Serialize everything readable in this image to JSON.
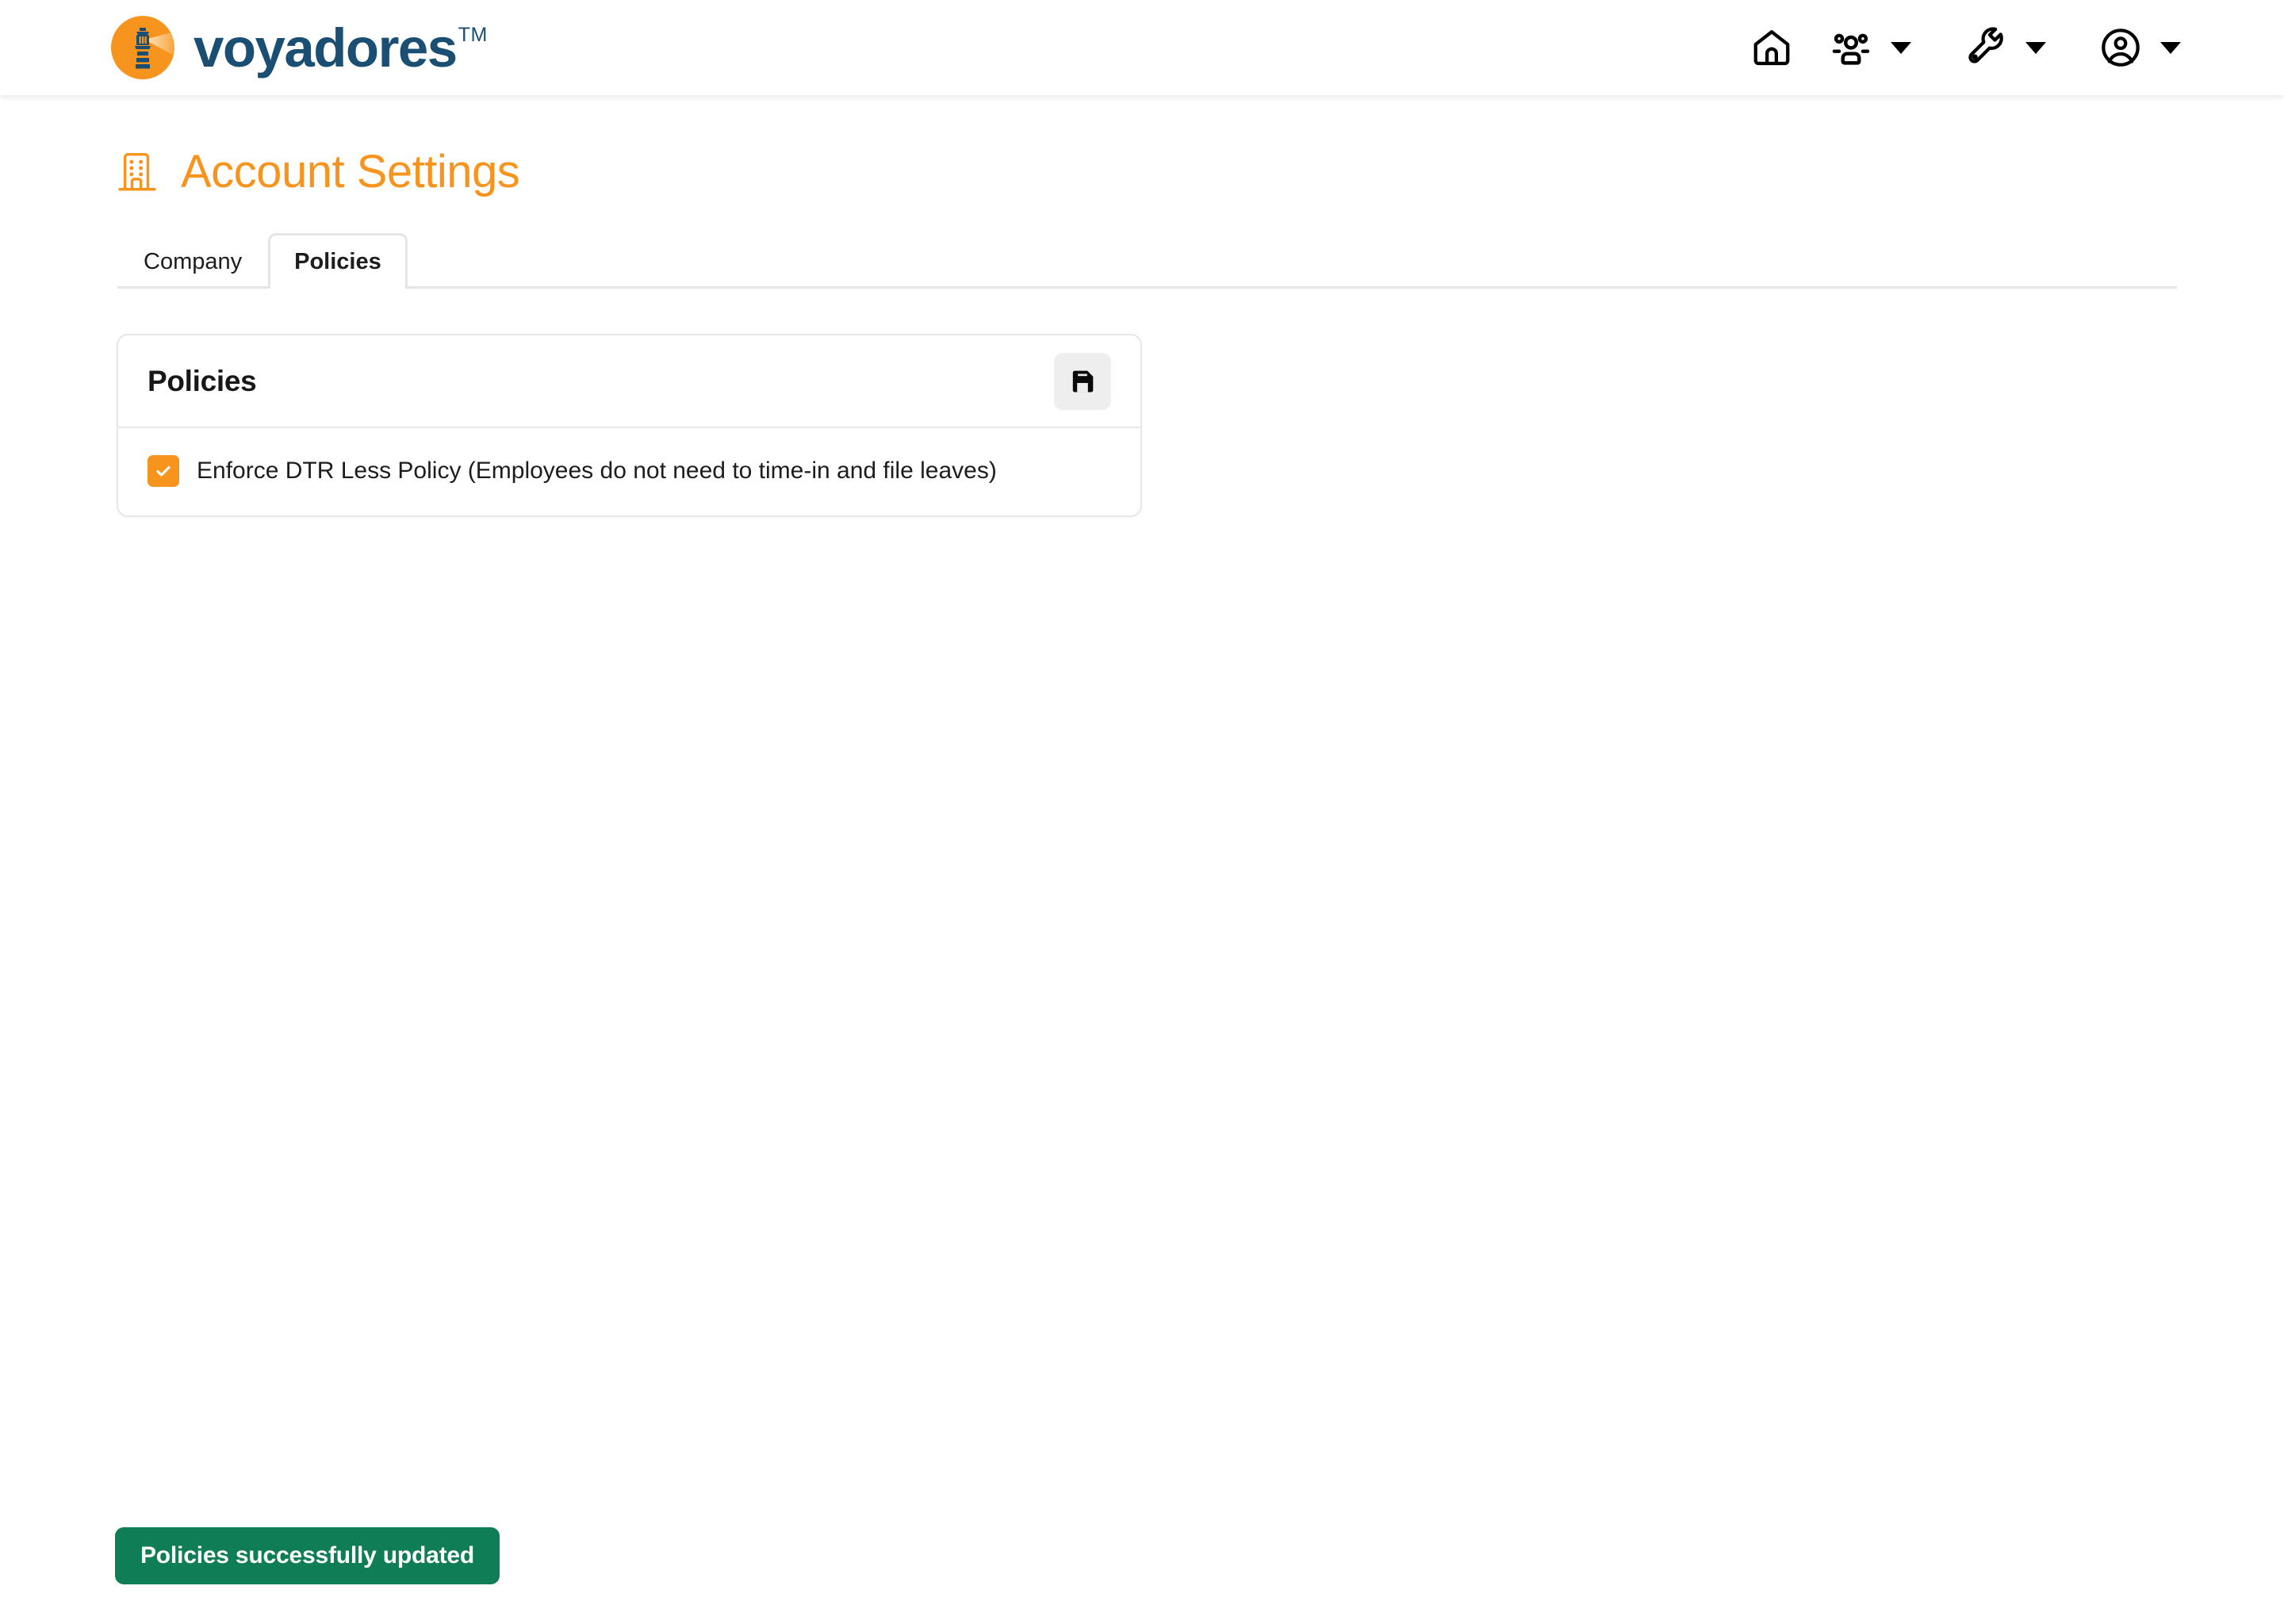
{
  "header": {
    "brand": {
      "name": "voyadores",
      "trademark": "TM",
      "logo_icon": "lighthouse-icon",
      "logo_bg_color": "#F7941E",
      "logo_fg_color": "#1A4F73",
      "word_color": "#1A4F73"
    },
    "nav": [
      {
        "id": "home",
        "icon": "home-icon",
        "has_caret": false
      },
      {
        "id": "people",
        "icon": "users-group-icon",
        "has_caret": true
      },
      {
        "id": "tools",
        "icon": "wrench-icon",
        "has_caret": true
      },
      {
        "id": "account",
        "icon": "user-circle-icon",
        "has_caret": true
      }
    ]
  },
  "page": {
    "title": "Account Settings",
    "title_icon": "building-icon",
    "title_color": "#F7941E"
  },
  "tabs": [
    {
      "label": "Company",
      "active": false
    },
    {
      "label": "Policies",
      "active": true
    }
  ],
  "card": {
    "title": "Policies",
    "save_button": {
      "icon": "save-floppy-icon",
      "label": ""
    },
    "options": [
      {
        "label": "Enforce DTR Less Policy (Employees do not need to time-in and file leaves)",
        "checked": true,
        "accent_color": "#F7941E"
      }
    ]
  },
  "toast": {
    "message": "Policies successfully updated",
    "background_color": "#0F7D55",
    "text_color": "#FFFFFF"
  }
}
